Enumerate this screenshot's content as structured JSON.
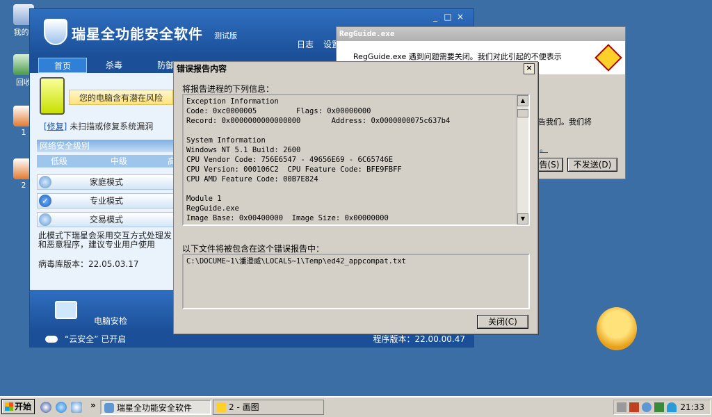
{
  "desktop": {
    "icons": [
      {
        "label": "我的E"
      },
      {
        "label": "回收"
      },
      {
        "label": "1"
      },
      {
        "label": "2"
      }
    ]
  },
  "rising": {
    "title": "瑞星全功能安全软件",
    "edition": "测试版",
    "window_controls": [
      "_",
      "□",
      "×"
    ],
    "top_links": {
      "log": "日志",
      "settings": "设置"
    },
    "tabs": [
      {
        "label": "首页"
      },
      {
        "label": "杀毒"
      },
      {
        "label": "防御"
      }
    ],
    "risk_text": "您的电脑含有潜在风险",
    "fix_link": "[修复]",
    "fix_text": "未扫描或修复系统漏洞",
    "security_level_header": "网络安全级别",
    "levels": [
      "低级",
      "中级",
      "高"
    ],
    "modes": [
      {
        "label": "家庭模式",
        "checked": false
      },
      {
        "label": "专业模式",
        "checked": true
      },
      {
        "label": "交易模式",
        "checked": false
      }
    ],
    "description": "此模式下瑞星会采用交互方式处理发\n和恶意程序，建议专业用户使用",
    "virus_db": "病毒库版本：22.05.03.17",
    "bottom_feature": "电脑安检",
    "cloud_status": "“云安全” 已开启",
    "program_version": "程序版本：22.00.00.47"
  },
  "error_report": {
    "title": "错误报告内容",
    "close_x": "×",
    "label_info": "将报告进程的下列信息：",
    "info_lines": "Exception Information\nCode: 0xc0000005         Flags: 0x00000000\nRecord: 0x0000000000000000       Address: 0x0000000075c637b4\n\nSystem Information\nWindows NT 5.1 Build: 2600\nCPU Vendor Code: 756E6547 - 49656E69 - 6C65746E\nCPU Version: 000106C2  CPU Feature Code: BFE9FBFF\nCPU AMD Feature Code: 00B7E824\n\nModule 1\nRegGuide.exe\nImage Base: 0x00400000  Image Size: 0x00000000",
    "label_files": "以下文件将被包含在这个错误报告中：",
    "file_path": "C:\\DOCUME~1\\潘澄威\\LOCALS~1\\Temp\\ed42_appcompat.txt",
    "close_button": "关闭(C)"
  },
  "regguide": {
    "title": "RegGuide.exe",
    "message": "RegGuide.exe 遇到问题需要关闭。我们对此引起的不便表示",
    "partial_text": "告我们。我们将",
    "link_fragment": "。",
    "send_button": "告(S)",
    "dont_send_button": "不发送(D)"
  },
  "taskbar": {
    "start": "开始",
    "chevron": "»",
    "tasks": [
      {
        "label": "瑞星全功能安全软件",
        "active": true
      },
      {
        "label": "2 - 画图",
        "active": false
      }
    ],
    "clock": "21:33"
  },
  "colors": {
    "desktop": "#3a6ea5",
    "rising_blue": "#1b4f98",
    "dialog_gray": "#d4d0c8"
  }
}
